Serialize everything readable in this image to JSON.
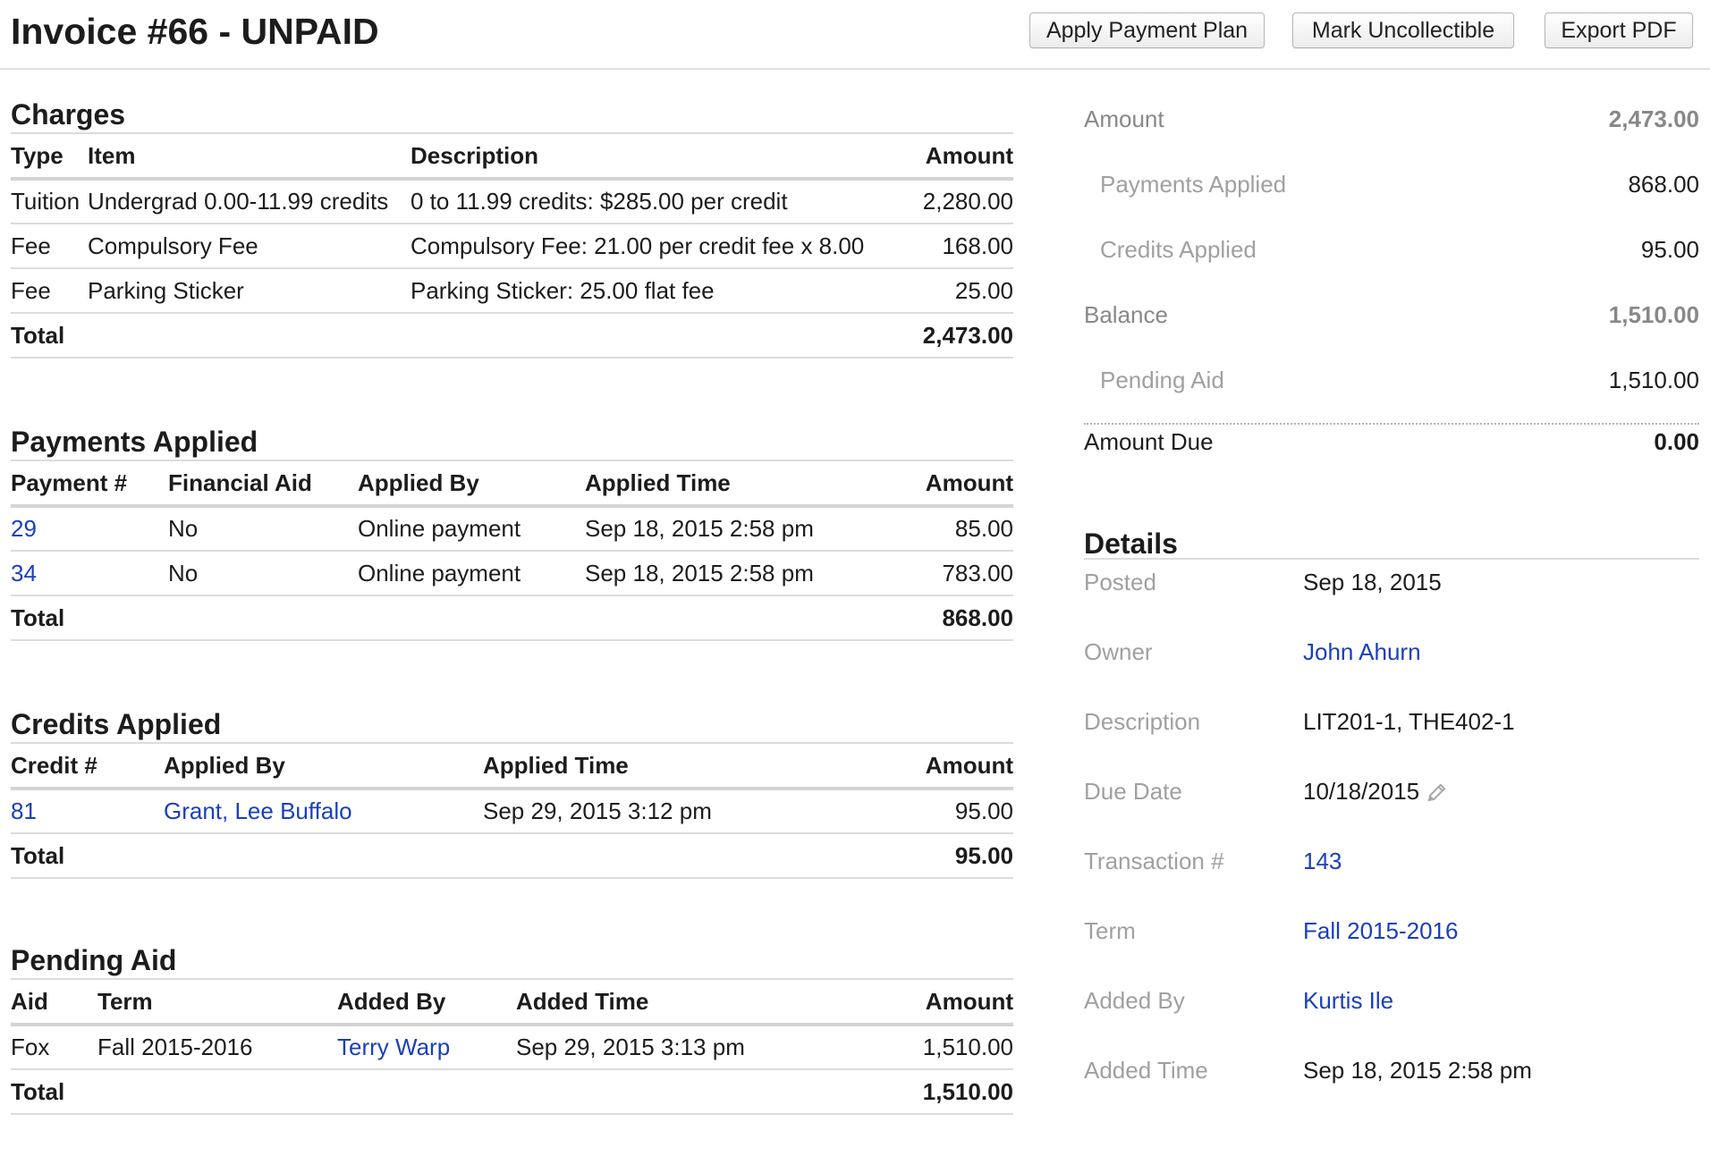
{
  "header": {
    "title": "Invoice #66 - UNPAID",
    "buttons": {
      "apply_payment_plan": "Apply Payment Plan",
      "mark_uncollectible": "Mark Uncollectible",
      "export_pdf": "Export PDF"
    }
  },
  "charges": {
    "title": "Charges",
    "columns": [
      "Type",
      "Item",
      "Description",
      "Amount"
    ],
    "rows": [
      {
        "type": "Tuition",
        "item": "Undergrad 0.00-11.99 credits",
        "description": "0 to 11.99 credits: $285.00 per credit",
        "amount": "2,280.00"
      },
      {
        "type": "Fee",
        "item": "Compulsory Fee",
        "description": "Compulsory Fee: 21.00 per credit fee x 8.00",
        "amount": "168.00"
      },
      {
        "type": "Fee",
        "item": "Parking Sticker",
        "description": "Parking Sticker: 25.00 flat fee",
        "amount": "25.00"
      }
    ],
    "total_label": "Total",
    "total": "2,473.00"
  },
  "payments": {
    "title": "Payments Applied",
    "columns": [
      "Payment #",
      "Financial Aid",
      "Applied By",
      "Applied Time",
      "Amount"
    ],
    "rows": [
      {
        "payment": "29",
        "financial_aid": "No",
        "applied_by": "Online payment",
        "applied_time": "Sep 18, 2015 2:58 pm",
        "amount": "85.00"
      },
      {
        "payment": "34",
        "financial_aid": "No",
        "applied_by": "Online payment",
        "applied_time": "Sep 18, 2015 2:58 pm",
        "amount": "783.00"
      }
    ],
    "total_label": "Total",
    "total": "868.00"
  },
  "credits": {
    "title": "Credits Applied",
    "columns": [
      "Credit #",
      "Applied By",
      "Applied Time",
      "Amount"
    ],
    "rows": [
      {
        "credit": "81",
        "applied_by": "Grant, Lee Buffalo",
        "applied_time": "Sep 29, 2015 3:12 pm",
        "amount": "95.00"
      }
    ],
    "total_label": "Total",
    "total": "95.00"
  },
  "pending": {
    "title": "Pending Aid",
    "columns": [
      "Aid",
      "Term",
      "Added By",
      "Added Time",
      "Amount"
    ],
    "rows": [
      {
        "aid": "Fox",
        "term": "Fall 2015-2016",
        "added_by": "Terry Warp",
        "added_time": "Sep 29, 2015 3:13 pm",
        "amount": "1,510.00"
      }
    ],
    "total_label": "Total",
    "total": "1,510.00"
  },
  "summary": {
    "amount_label": "Amount",
    "amount": "2,473.00",
    "payments_applied_label": "Payments Applied",
    "payments_applied": "868.00",
    "credits_applied_label": "Credits Applied",
    "credits_applied": "95.00",
    "balance_label": "Balance",
    "balance": "1,510.00",
    "pending_aid_label": "Pending Aid",
    "pending_aid": "1,510.00",
    "amount_due_label": "Amount Due",
    "amount_due": "0.00"
  },
  "details": {
    "title": "Details",
    "posted_label": "Posted",
    "posted": "Sep 18, 2015",
    "owner_label": "Owner",
    "owner": "John Ahurn",
    "description_label": "Description",
    "description": "LIT201-1, THE402-1",
    "due_date_label": "Due Date",
    "due_date": "10/18/2015",
    "transaction_label": "Transaction #",
    "transaction": "143",
    "term_label": "Term",
    "term": "Fall 2015-2016",
    "added_by_label": "Added By",
    "added_by": "Kurtis Ile",
    "added_time_label": "Added Time",
    "added_time": "Sep 18, 2015 2:58 pm"
  }
}
